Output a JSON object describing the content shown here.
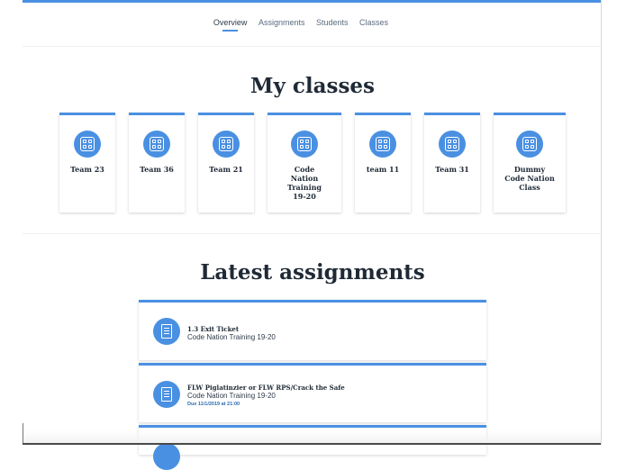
{
  "nav": {
    "tabs": [
      {
        "label": "Overview",
        "active": true
      },
      {
        "label": "Assignments",
        "active": false
      },
      {
        "label": "Students",
        "active": false
      },
      {
        "label": "Classes",
        "active": false
      }
    ]
  },
  "classes_section": {
    "title": "My classes",
    "classes": [
      {
        "name": "Team 23",
        "icon": "grid-icon"
      },
      {
        "name": "Team 36",
        "icon": "grid-icon"
      },
      {
        "name": "Team 21",
        "icon": "grid-icon"
      },
      {
        "name": "Code Nation Training 19-20",
        "icon": "grid-icon"
      },
      {
        "name": "team 11",
        "icon": "grid-icon"
      },
      {
        "name": "Team 31",
        "icon": "grid-icon"
      },
      {
        "name": "Dummy Code Nation Class",
        "icon": "grid-icon"
      }
    ]
  },
  "assignments_section": {
    "title": "Latest assignments",
    "assignments": [
      {
        "title": "1.3 Exit Ticket",
        "class": "Code Nation Training 19-20",
        "due": "",
        "icon": "document-icon"
      },
      {
        "title": "FLW Piglatinzier or FLW RPS/Crack the Safe",
        "class": "Code Nation Training 19-20",
        "due": "Due 11/1/2019 at 21:00",
        "icon": "document-icon"
      }
    ]
  },
  "colors": {
    "accent": "#4a90e2",
    "heading": "#1f2a36",
    "nav_text": "#5a6b80"
  }
}
